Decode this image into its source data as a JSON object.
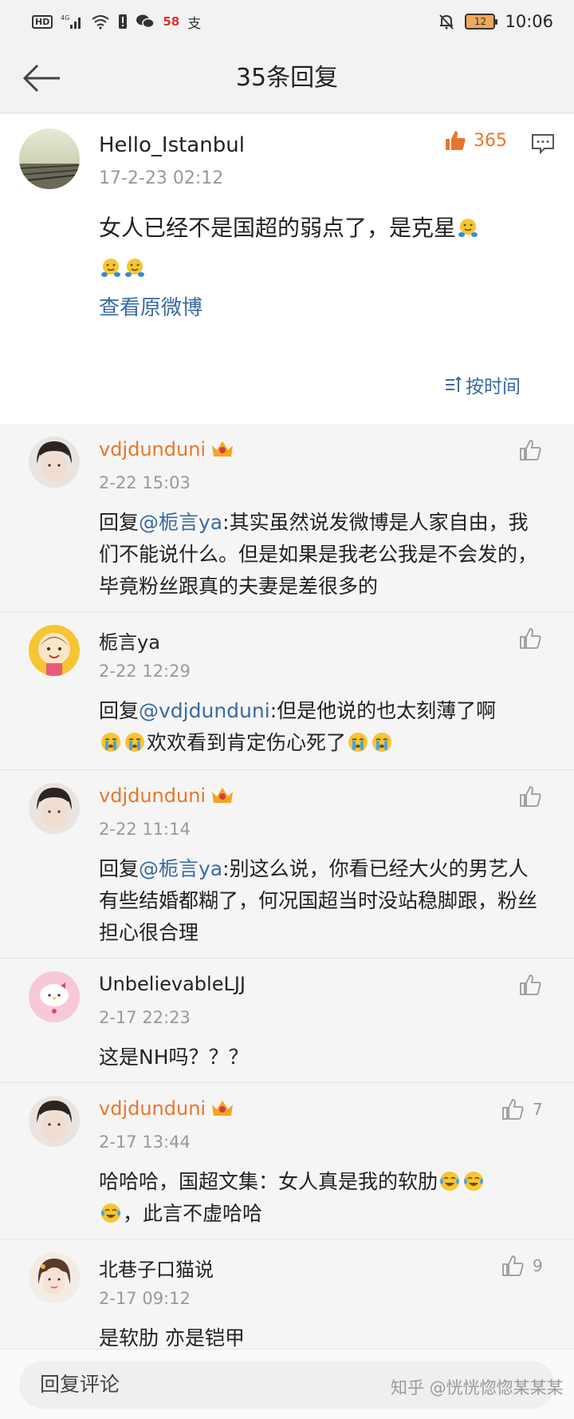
{
  "status_bar": {
    "hd": "HD",
    "network": "4G",
    "app_badge": "58",
    "pay_glyph": "支",
    "battery": "12",
    "time": "10:06"
  },
  "header": {
    "title": "35条回复"
  },
  "post": {
    "user": "Hello_Istanbul",
    "time": "17-2-23 02:12",
    "likes": "365",
    "text": "女人已经不是国超的弱点了，是克星",
    "view_original": "查看原微博",
    "sort_label": "按时间"
  },
  "comments": [
    {
      "user": "vdjdunduni",
      "time": "2-22 15:03",
      "prefix": "回复",
      "mention": "@栀言ya",
      "text": ":其实虽然说发微博是人家自由，我们不能说什么。但是如果是我老公我是不会发的，毕竟粉丝跟真的夫妻是差很多的",
      "likes": ""
    },
    {
      "user": "栀言ya",
      "time": "2-22 12:29",
      "prefix": "回复",
      "mention": "@vdjdunduni",
      "text": ":但是他说的也太刻薄了啊",
      "text_after": "欢欢看到肯定伤心死了",
      "likes": ""
    },
    {
      "user": "vdjdunduni",
      "time": "2-22 11:14",
      "prefix": "回复",
      "mention": "@栀言ya",
      "text": ":别这么说，你看已经大火的男艺人 有些结婚都糊了，何况国超当时没站稳脚跟，粉丝担心很合理",
      "likes": ""
    },
    {
      "user": "UnbelievableLJJ",
      "time": "2-17 22:23",
      "text": "这是NH吗？？？",
      "likes": ""
    },
    {
      "user": "vdjdunduni",
      "time": "2-17 13:44",
      "text": "哈哈哈，国超文集：女人真是我的软肋",
      "text_after": "，此言不虚哈哈",
      "likes": "7"
    },
    {
      "user": "北巷子口猫说",
      "time": "2-17 09:12",
      "text": "是软肋 亦是铠甲",
      "likes": "9"
    }
  ],
  "bottom": {
    "reply_placeholder": "回复评论",
    "watermark": "知乎 @恍恍惚惚某某某"
  },
  "colors": {
    "vip_name": "#e8762d",
    "link": "#3a6b9e",
    "like_active": "#e8762d"
  }
}
